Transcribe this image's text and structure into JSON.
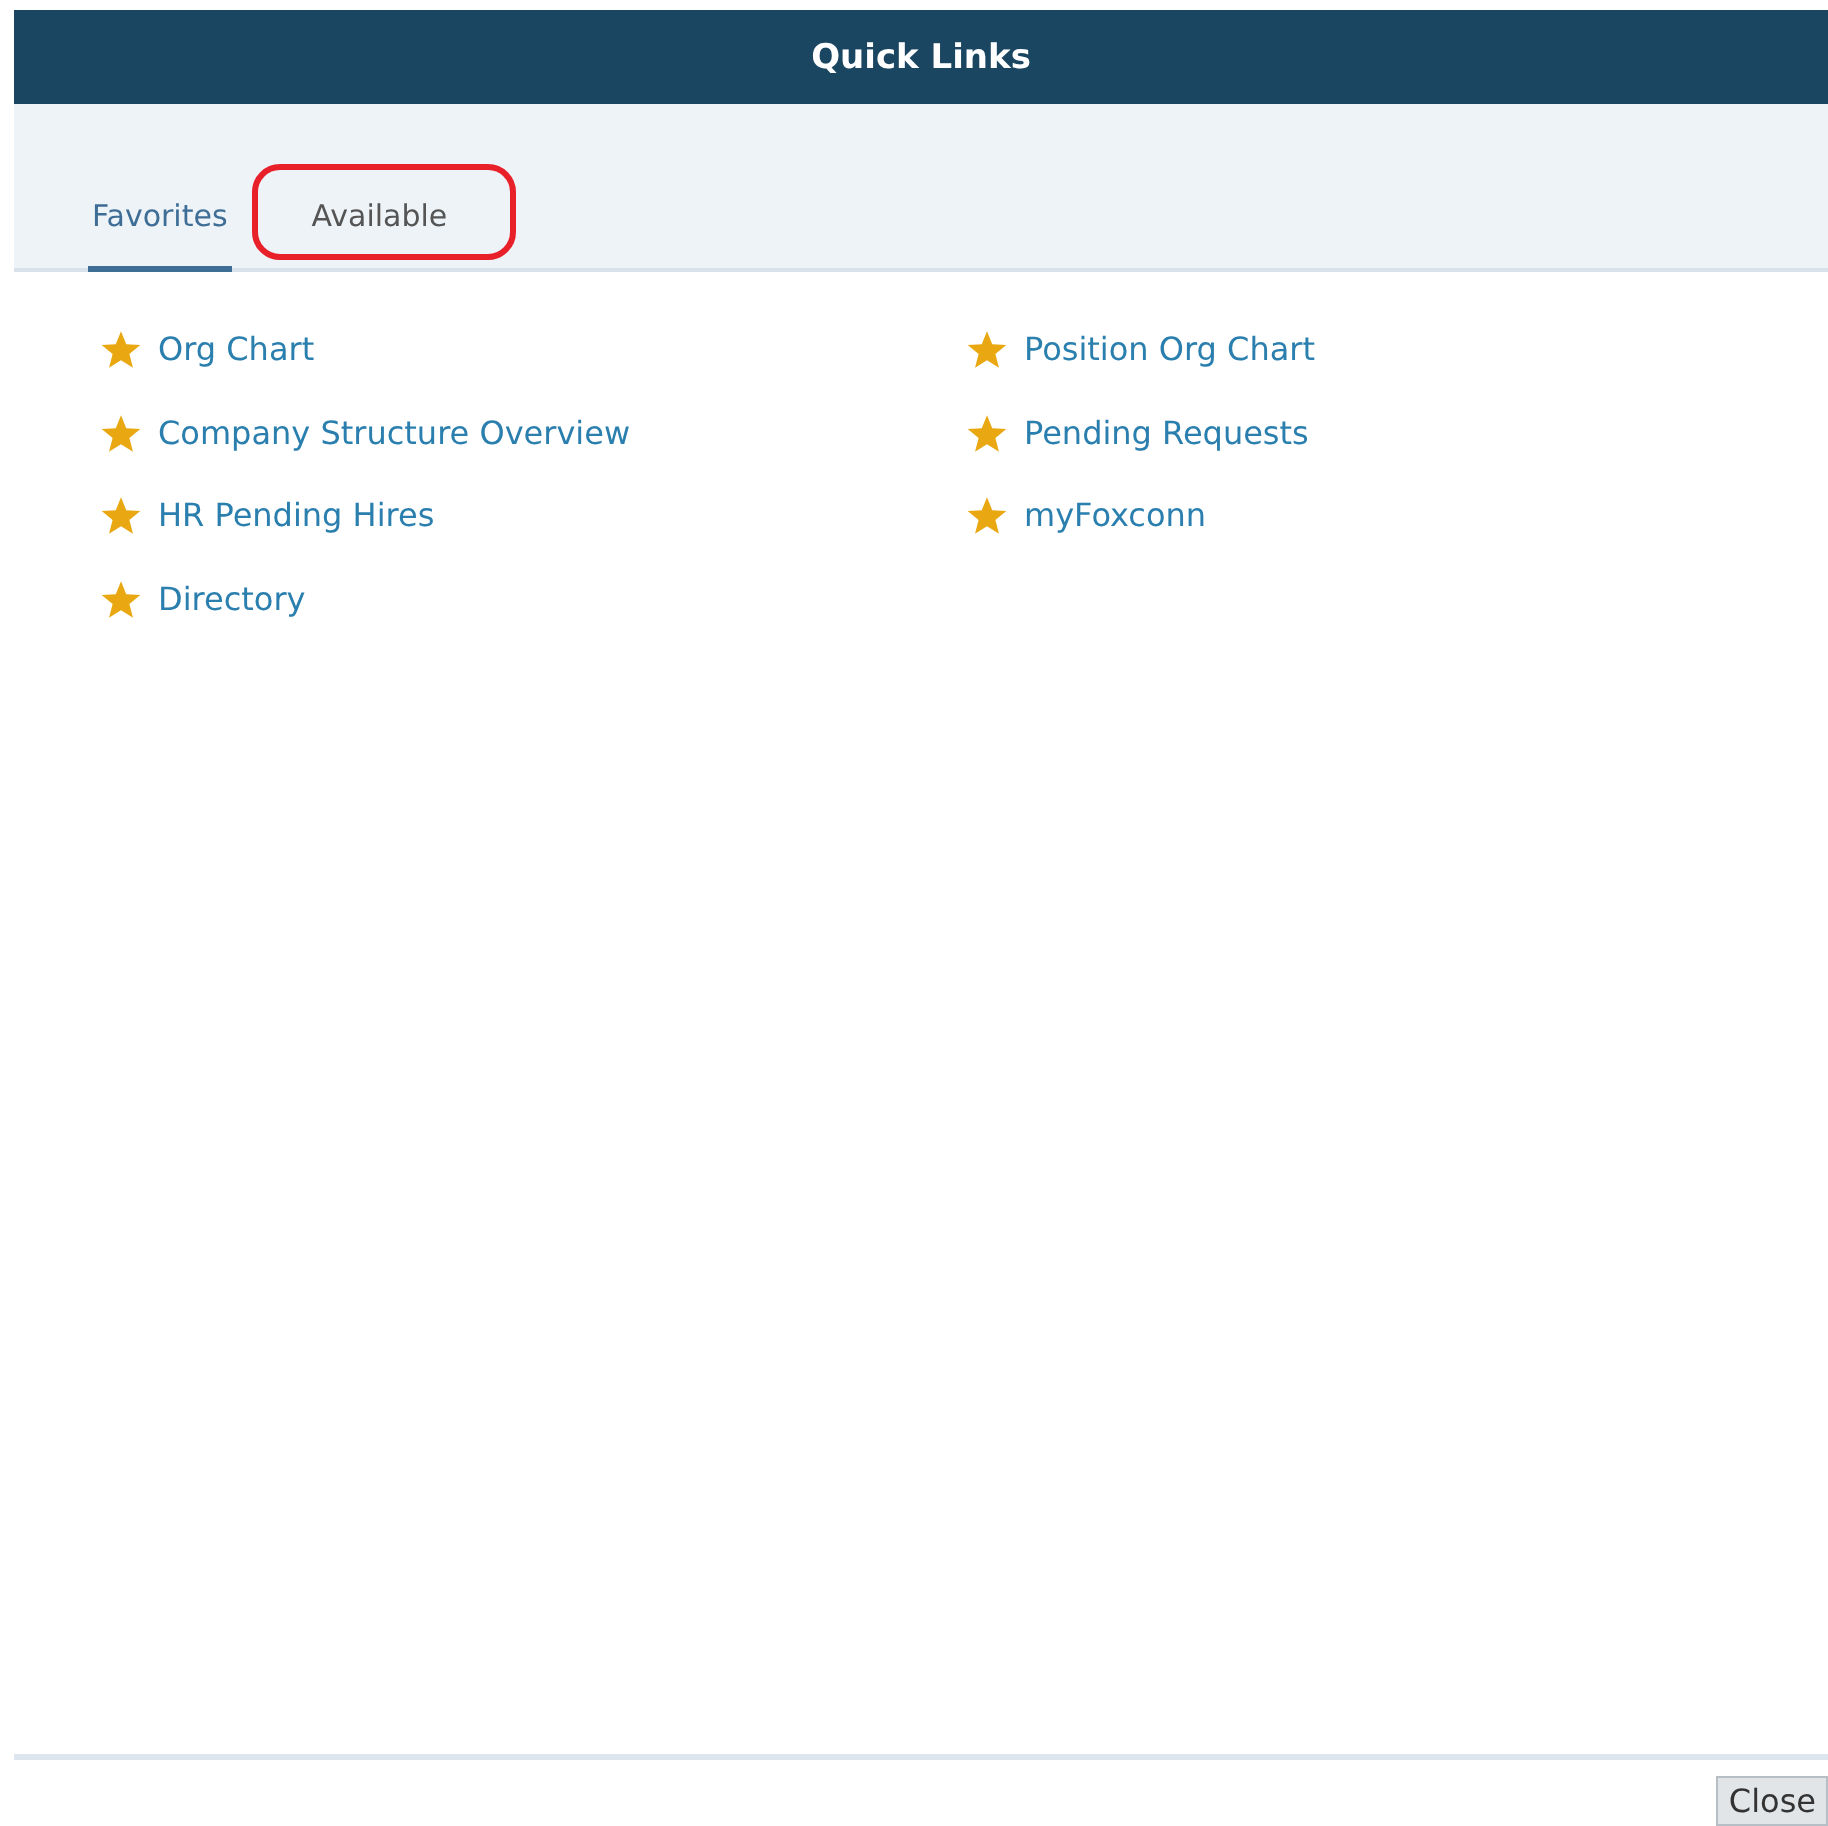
{
  "dialog": {
    "title": "Quick Links"
  },
  "tabs": [
    {
      "label": "Favorites",
      "selected": true,
      "highlighted": false
    },
    {
      "label": "Available",
      "selected": false,
      "highlighted": true
    }
  ],
  "link_columns": [
    [
      "Org Chart",
      "Company Structure Overview",
      "HR Pending Hires",
      "Directory"
    ],
    [
      "Position Org Chart",
      "Pending Requests",
      "myFoxconn"
    ]
  ],
  "buttons": [
    "Close"
  ]
}
